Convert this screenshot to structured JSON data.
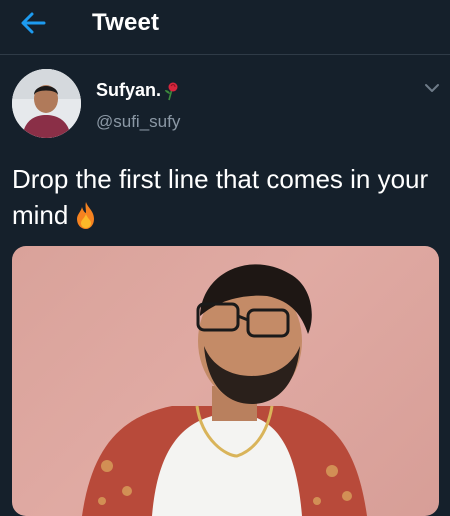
{
  "header": {
    "title": "Tweet",
    "back_icon": "arrow-left-icon"
  },
  "tweet": {
    "author_name": "Sufyan.",
    "author_handle": "@sufi_sufy",
    "text": "Drop the first line that comes in your mind",
    "emoji_icon": "fire-icon",
    "menu_icon": "chevron-down-icon"
  },
  "colors": {
    "background": "#15202b",
    "accent": "#1d9bf0",
    "secondary_text": "#8b98a5",
    "primary_text": "#ffffff"
  }
}
